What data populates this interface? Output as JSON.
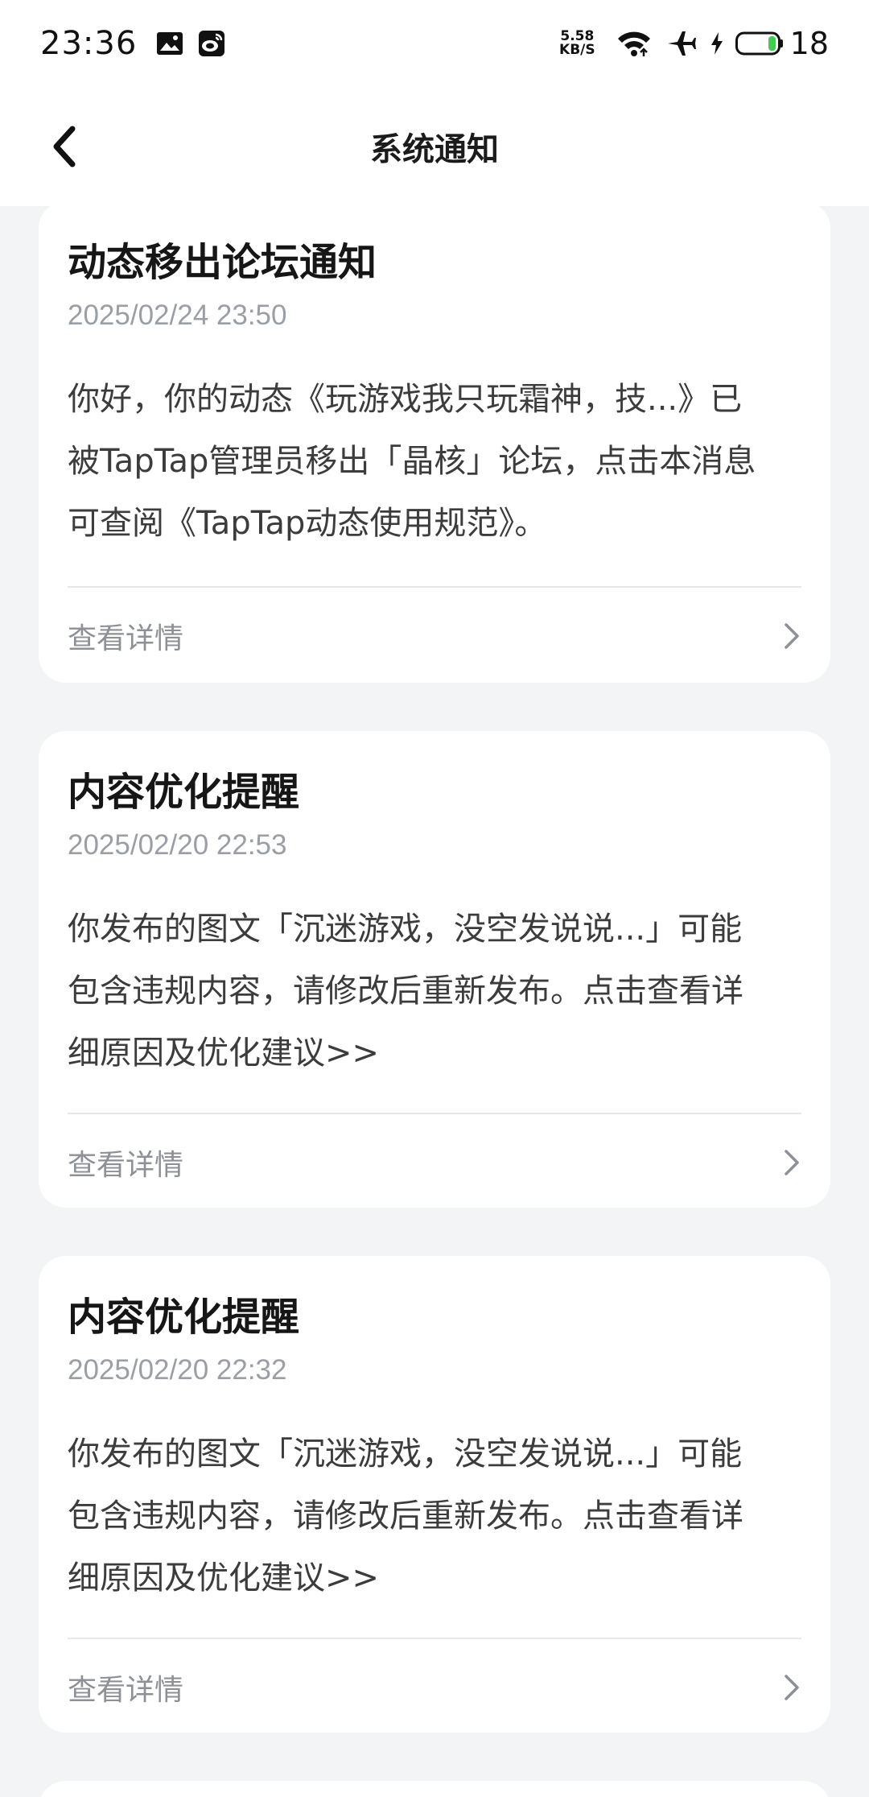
{
  "status_bar": {
    "time": "23:36",
    "net_speed_value": "5.58",
    "net_speed_unit": "KB/S",
    "battery_level": "18",
    "icons": [
      "gallery-icon",
      "weibo-icon",
      "wifi-icon",
      "airplane-mode-icon",
      "charging-icon",
      "battery-icon"
    ]
  },
  "header": {
    "title": "系统通知",
    "back_icon": "chevron-left-icon"
  },
  "notifications": [
    {
      "title": "动态移出论坛通知",
      "time": "2025/02/24 23:50",
      "body_lines": [
        "你好，你的动态《玩游戏我只玩霜神，技...》已",
        "被TapTap管理员移出「晶核」论坛，点击本消息",
        "可查阅《TapTap动态使用规范》。"
      ],
      "footer_label": "查看详情"
    },
    {
      "title": "内容优化提醒",
      "time": "2025/02/20 22:53",
      "body_lines": [
        "你发布的图文「沉迷游戏，没空发说说...」可能",
        "包含违规内容，请修改后重新发布。点击查看详",
        "细原因及优化建议>>"
      ],
      "footer_label": "查看详情"
    },
    {
      "title": "内容优化提醒",
      "time": "2025/02/20 22:32",
      "body_lines": [
        "你发布的图文「沉迷游戏，没空发说说...」可能",
        "包含违规内容，请修改后重新发布。点击查看详",
        "细原因及优化建议>>"
      ],
      "footer_label": "查看详情"
    }
  ],
  "colors": {
    "background": "#f3f4f6",
    "card": "#ffffff",
    "title": "#161616",
    "timestamp": "#9a9ea5",
    "body": "#3c3c3c",
    "footer_label": "#8d9096",
    "battery_fill": "#3bd14a"
  }
}
